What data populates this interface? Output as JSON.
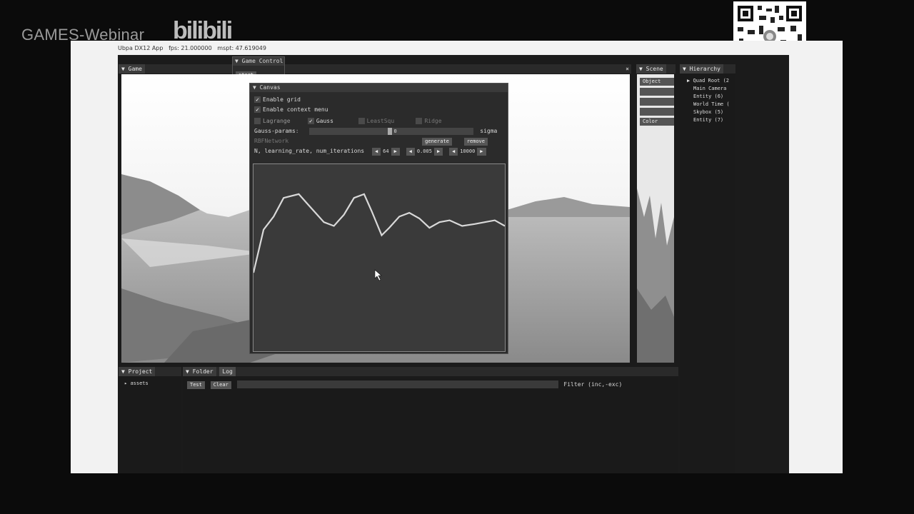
{
  "watermark": {
    "text": "GAMES-Webinar",
    "bilibili": "bilibili"
  },
  "app": {
    "title": "Ubpa DX12 App",
    "fps": "fps: 21.000000",
    "mspt": "mspt: 47.619049"
  },
  "game_tab": "Game",
  "game_control": {
    "title": "Game Control",
    "start_button": "start"
  },
  "canvas": {
    "title": "Canvas",
    "enable_grid": "Enable grid",
    "enable_context_menu": "Enable context menu",
    "methods": [
      {
        "label": "Lagrange",
        "checked": false
      },
      {
        "label": "Gauss",
        "checked": true
      },
      {
        "label": "LeastSqu",
        "checked": false
      },
      {
        "label": "Ridge",
        "checked": false
      }
    ],
    "gauss_params_label": "Gauss-params",
    "gauss_params_value": "0",
    "sigma_label": "sigma",
    "section_label": "RBFNetwork",
    "generate_button": "generate",
    "remove_button": "remove",
    "training_label": "N, learning_rate, num_iterations",
    "N": "64",
    "learning_rate": "0.005",
    "num_iterations": "10000"
  },
  "scene_tab": "Scene",
  "scene_buttons": [
    "Object",
    "",
    "",
    "",
    "Color"
  ],
  "hierarchy": {
    "title": "Hierarchy",
    "items": [
      "Quad Root (2",
      "Main Camera",
      "Entity (6)",
      "World Time (",
      "Skybox (5)",
      "Entity (7)"
    ]
  },
  "project": {
    "title": "Project",
    "items": [
      "assets"
    ]
  },
  "log": {
    "tabs": [
      "Folder",
      "Log"
    ],
    "test_button": "Test",
    "clear_button": "Clear",
    "filter_label": "Filter (inc,-exc)"
  },
  "colors": {
    "curve": "#d9d9d9",
    "plot_bg": "#3a3a3a",
    "panel_bg": "#1b1b1b",
    "slide_bg": "#f2f2f2"
  },
  "icons": [
    "collapse-triangle-icon",
    "check-icon",
    "arrow-left-icon",
    "arrow-right-icon",
    "mouse-cursor-icon",
    "qr-code-icon"
  ],
  "curve_samples": [
    [
      0,
      0.58
    ],
    [
      0.04,
      0.35
    ],
    [
      0.08,
      0.28
    ],
    [
      0.12,
      0.18
    ],
    [
      0.18,
      0.16
    ],
    [
      0.22,
      0.22
    ],
    [
      0.28,
      0.31
    ],
    [
      0.32,
      0.33
    ],
    [
      0.36,
      0.27
    ],
    [
      0.4,
      0.18
    ],
    [
      0.44,
      0.16
    ],
    [
      0.47,
      0.25
    ],
    [
      0.51,
      0.38
    ],
    [
      0.54,
      0.34
    ],
    [
      0.58,
      0.28
    ],
    [
      0.62,
      0.26
    ],
    [
      0.66,
      0.29
    ],
    [
      0.7,
      0.34
    ],
    [
      0.74,
      0.31
    ],
    [
      0.78,
      0.3
    ],
    [
      0.83,
      0.33
    ],
    [
      0.88,
      0.32
    ],
    [
      0.92,
      0.31
    ],
    [
      0.96,
      0.3
    ],
    [
      1.0,
      0.33
    ]
  ]
}
